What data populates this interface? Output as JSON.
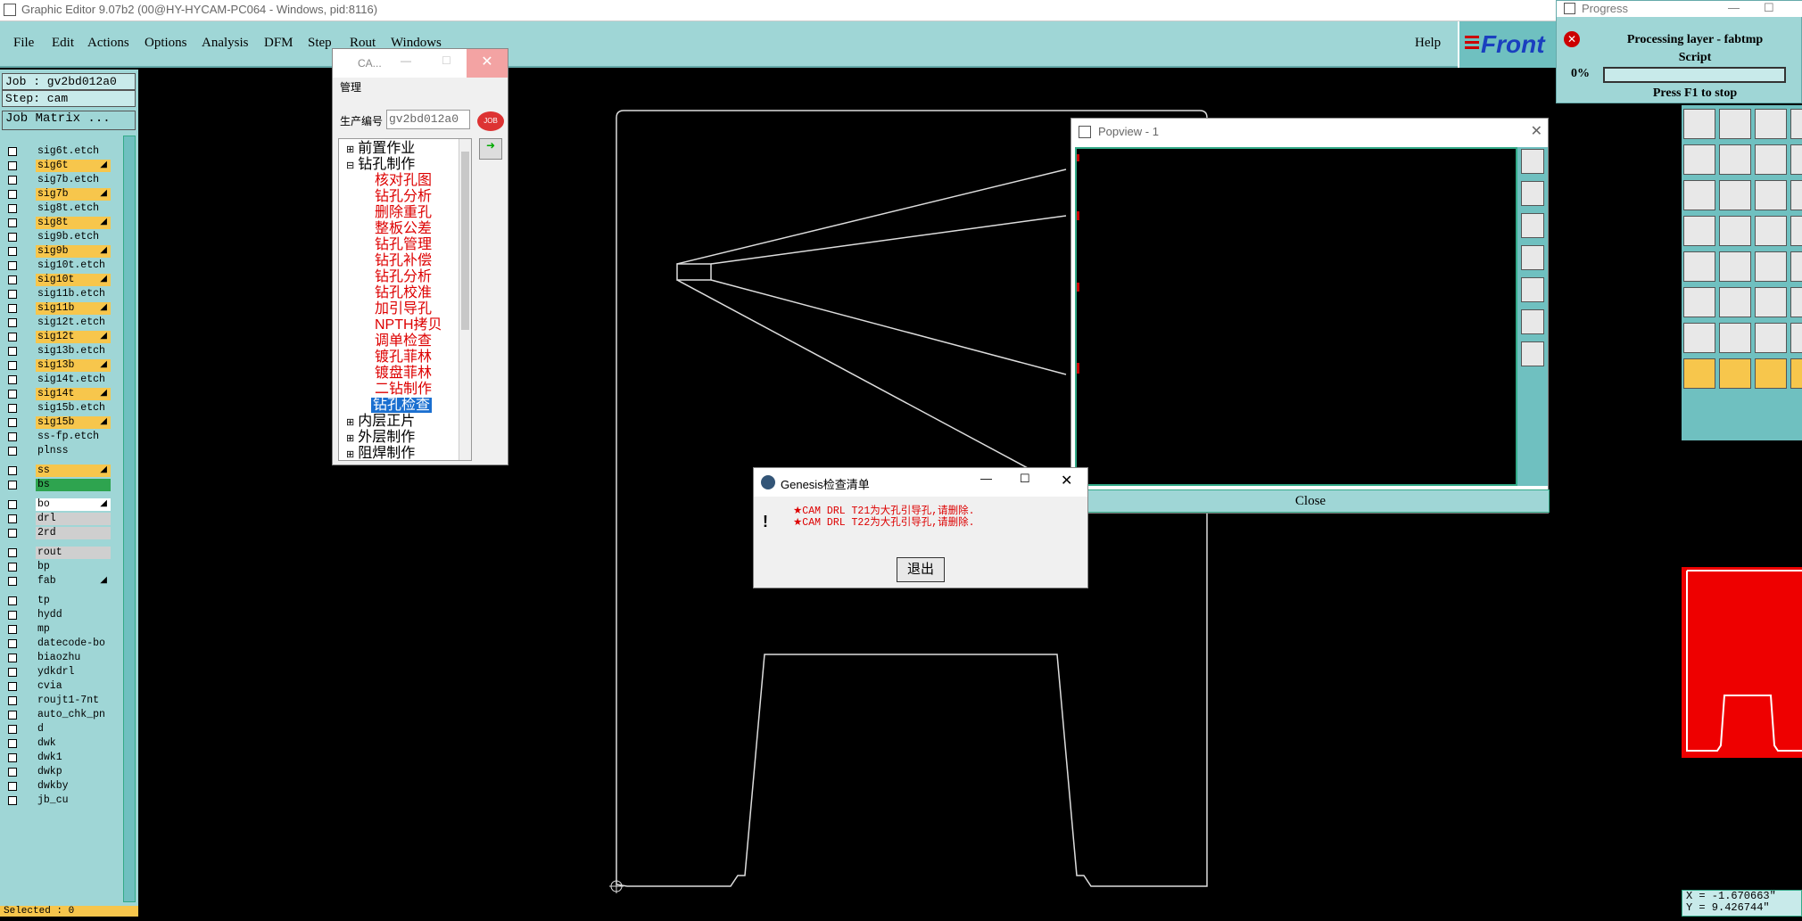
{
  "window": {
    "title": "Graphic Editor 9.07b2 (00@HY-HYCAM-PC064 - Windows, pid:8116)"
  },
  "menubar": {
    "items": [
      "File",
      "Edit",
      "Actions",
      "Options",
      "Analysis",
      "DFM",
      "Step",
      "Rout",
      "Windows"
    ],
    "help": "Help",
    "logo": "Front"
  },
  "left": {
    "job": "Job : gv2bd012a0",
    "step": "Step: cam",
    "job_matrix": "Job Matrix ...",
    "layers": [
      {
        "name": "sig6t.etch",
        "color": "#9fd6d6"
      },
      {
        "name": "sig6t",
        "color": "#f7c64c",
        "mark": "◢"
      },
      {
        "name": "sig7b.etch",
        "color": "#9fd6d6"
      },
      {
        "name": "sig7b",
        "color": "#f7c64c",
        "mark": "◢"
      },
      {
        "name": "sig8t.etch",
        "color": "#9fd6d6"
      },
      {
        "name": "sig8t",
        "color": "#f7c64c",
        "mark": "◢"
      },
      {
        "name": "sig9b.etch",
        "color": "#9fd6d6"
      },
      {
        "name": "sig9b",
        "color": "#f7c64c",
        "mark": "◢"
      },
      {
        "name": "sig10t.etch",
        "color": "#9fd6d6"
      },
      {
        "name": "sig10t",
        "color": "#f7c64c",
        "mark": "◢"
      },
      {
        "name": "sig11b.etch",
        "color": "#9fd6d6"
      },
      {
        "name": "sig11b",
        "color": "#f7c64c",
        "mark": "◢"
      },
      {
        "name": "sig12t.etch",
        "color": "#9fd6d6"
      },
      {
        "name": "sig12t",
        "color": "#f7c64c",
        "mark": "◢"
      },
      {
        "name": "sig13b.etch",
        "color": "#9fd6d6"
      },
      {
        "name": "sig13b",
        "color": "#f7c64c",
        "mark": "◢"
      },
      {
        "name": "sig14t.etch",
        "color": "#9fd6d6"
      },
      {
        "name": "sig14t",
        "color": "#f7c64c",
        "mark": "◢"
      },
      {
        "name": "sig15b.etch",
        "color": "#9fd6d6"
      },
      {
        "name": "sig15b",
        "color": "#f7c64c",
        "mark": "◢"
      },
      {
        "name": "ss-fp.etch",
        "color": "#9fd6d6"
      },
      {
        "name": "plnss",
        "color": "#9fd6d6"
      },
      {
        "name": "ss",
        "color": "#f7c64c",
        "mark": "◢"
      },
      {
        "name": "bs",
        "color": "#2ea44f"
      },
      {
        "name": "bo",
        "color": "#ffffff",
        "mark": "◢"
      },
      {
        "name": "drl",
        "color": "#cfcfcf"
      },
      {
        "name": "2rd",
        "color": "#cfcfcf"
      },
      {
        "name": "rout",
        "color": "#cfcfcf"
      },
      {
        "name": "bp",
        "color": "#9fd6d6"
      },
      {
        "name": "fab",
        "color": "#9fd6d6",
        "mark": "◢"
      },
      {
        "name": "tp",
        "color": "#9fd6d6"
      },
      {
        "name": "hydd",
        "color": "#9fd6d6"
      },
      {
        "name": "mp",
        "color": "#9fd6d6"
      },
      {
        "name": "datecode-bo",
        "color": "#9fd6d6"
      },
      {
        "name": "biaozhu",
        "color": "#9fd6d6"
      },
      {
        "name": "ydkdrl",
        "color": "#9fd6d6"
      },
      {
        "name": "cvia",
        "color": "#9fd6d6"
      },
      {
        "name": "roujt1-7nt",
        "color": "#9fd6d6"
      },
      {
        "name": "auto_chk_pn",
        "color": "#9fd6d6"
      },
      {
        "name": "d",
        "color": "#9fd6d6"
      },
      {
        "name": "dwk",
        "color": "#9fd6d6"
      },
      {
        "name": "dwk1",
        "color": "#9fd6d6"
      },
      {
        "name": "dwkp",
        "color": "#9fd6d6"
      },
      {
        "name": "dwkby",
        "color": "#9fd6d6"
      },
      {
        "name": "jb_cu",
        "color": "#9fd6d6"
      }
    ],
    "selected": "Selected : 0"
  },
  "cam": {
    "title": "CA...",
    "menu": "管理",
    "prod_label": "生产编号",
    "prod_value": "gv2bd012a0",
    "tree": [
      {
        "text": "前置作业",
        "kind": "group",
        "exp": "+"
      },
      {
        "text": "钻孔制作",
        "kind": "group",
        "exp": "-"
      },
      {
        "text": "核对孔图",
        "kind": "item"
      },
      {
        "text": "钻孔分析",
        "kind": "item"
      },
      {
        "text": "删除重孔",
        "kind": "item"
      },
      {
        "text": "整板公差",
        "kind": "item"
      },
      {
        "text": "钻孔管理",
        "kind": "item"
      },
      {
        "text": "钻孔补偿",
        "kind": "item"
      },
      {
        "text": "钻孔分析",
        "kind": "item"
      },
      {
        "text": "钻孔校准",
        "kind": "item"
      },
      {
        "text": "加引导孔",
        "kind": "item"
      },
      {
        "text": "NPTH拷贝",
        "kind": "item"
      },
      {
        "text": "调单检查",
        "kind": "item"
      },
      {
        "text": "镀孔菲林",
        "kind": "item"
      },
      {
        "text": "镀盘菲林",
        "kind": "item"
      },
      {
        "text": "二钻制作",
        "kind": "item"
      },
      {
        "text": "钻孔检查",
        "kind": "selected"
      },
      {
        "text": "内层正片",
        "kind": "group",
        "exp": "+"
      },
      {
        "text": "外层制作",
        "kind": "group",
        "exp": "+"
      },
      {
        "text": "阻焊制作",
        "kind": "group",
        "exp": "+"
      }
    ]
  },
  "genesis": {
    "title": "Genesis检查清单",
    "lines": [
      "★CAM DRL T21为大孔引导孔,请删除.",
      "★CAM DRL T22为大孔引导孔,请删除."
    ],
    "button": "退出"
  },
  "popview": {
    "title": "Popview - 1",
    "close": "Close"
  },
  "progress": {
    "title": "Progress",
    "line1": "Processing layer - fabtmp",
    "line2": "Script",
    "pct": "0%",
    "value": 0,
    "hint": "Press F1 to stop"
  },
  "coords": {
    "x": "X = -1.670663\"",
    "y": "Y = 9.426744\""
  }
}
